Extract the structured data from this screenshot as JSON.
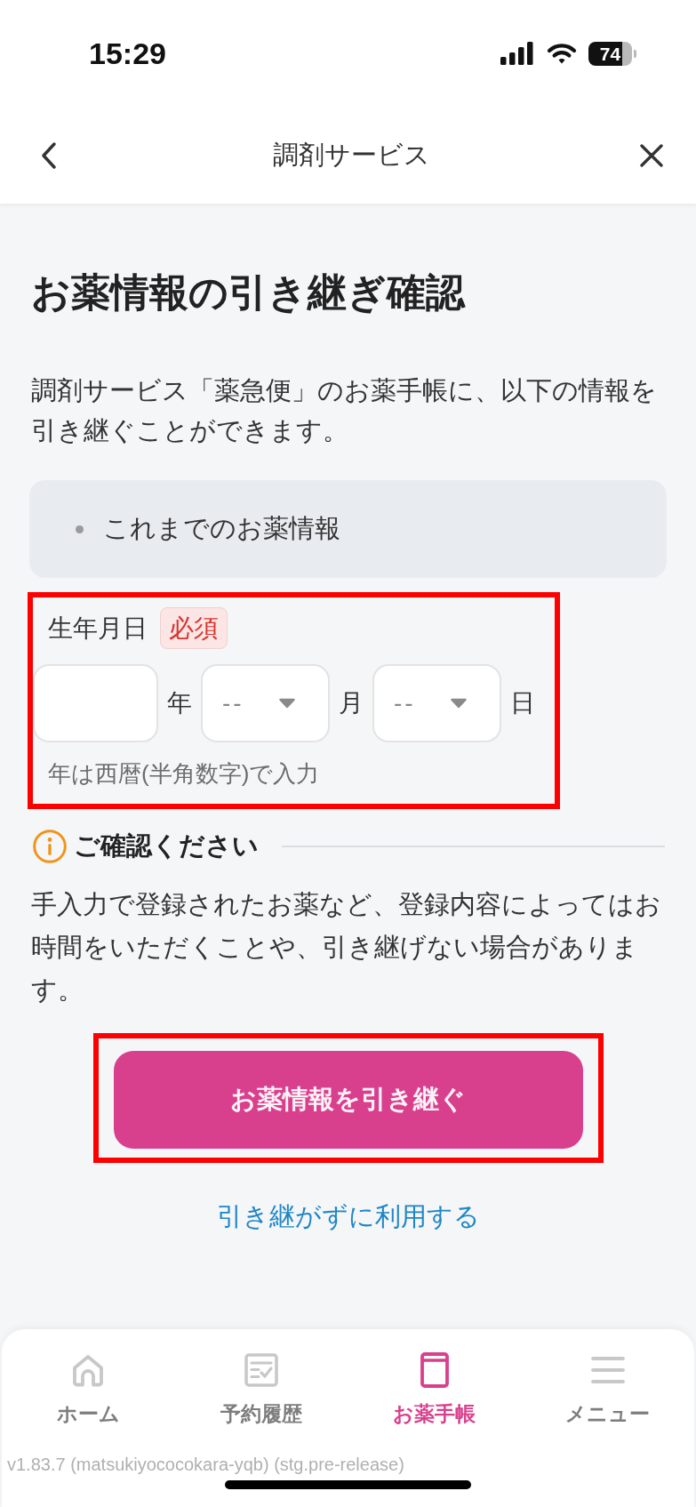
{
  "status_bar": {
    "time": "15:29",
    "battery": "74"
  },
  "header": {
    "title": "調剤サービス"
  },
  "page": {
    "title": "お薬情報の引き継ぎ確認",
    "description": "調剤サービス「薬急便」のお薬手帳に、以下の情報を引き継ぐことができます。",
    "items": [
      "これまでのお薬情報"
    ]
  },
  "birth_date": {
    "highlighted": true,
    "label": "生年月日",
    "badge": "必須",
    "fields": [
      {
        "kind": "input",
        "unit": "年"
      },
      {
        "kind": "select",
        "value": "--",
        "unit": "月"
      },
      {
        "kind": "select",
        "value": "--",
        "unit": "日"
      }
    ],
    "hint": "年は西暦(半角数字)で入力"
  },
  "notice": {
    "title": "ご確認ください",
    "text": "手入力で登録されたお薬など、登録内容によってはお時間をいただくことや、引き継げない場合があります。"
  },
  "primary_button": {
    "label": "お薬情報を引き継ぐ",
    "highlighted": true
  },
  "secondary_link": {
    "label": "引き継がずに利用する"
  },
  "tab_bar": [
    {
      "label": "ホーム",
      "selected": false
    },
    {
      "label": "予約履歴",
      "selected": false
    },
    {
      "label": "お薬手帳",
      "selected": true
    },
    {
      "label": "メニュー",
      "selected": false
    }
  ],
  "version": "v1.83.7 (matsukiyococokara-yqb) (stg.pre-release)"
}
